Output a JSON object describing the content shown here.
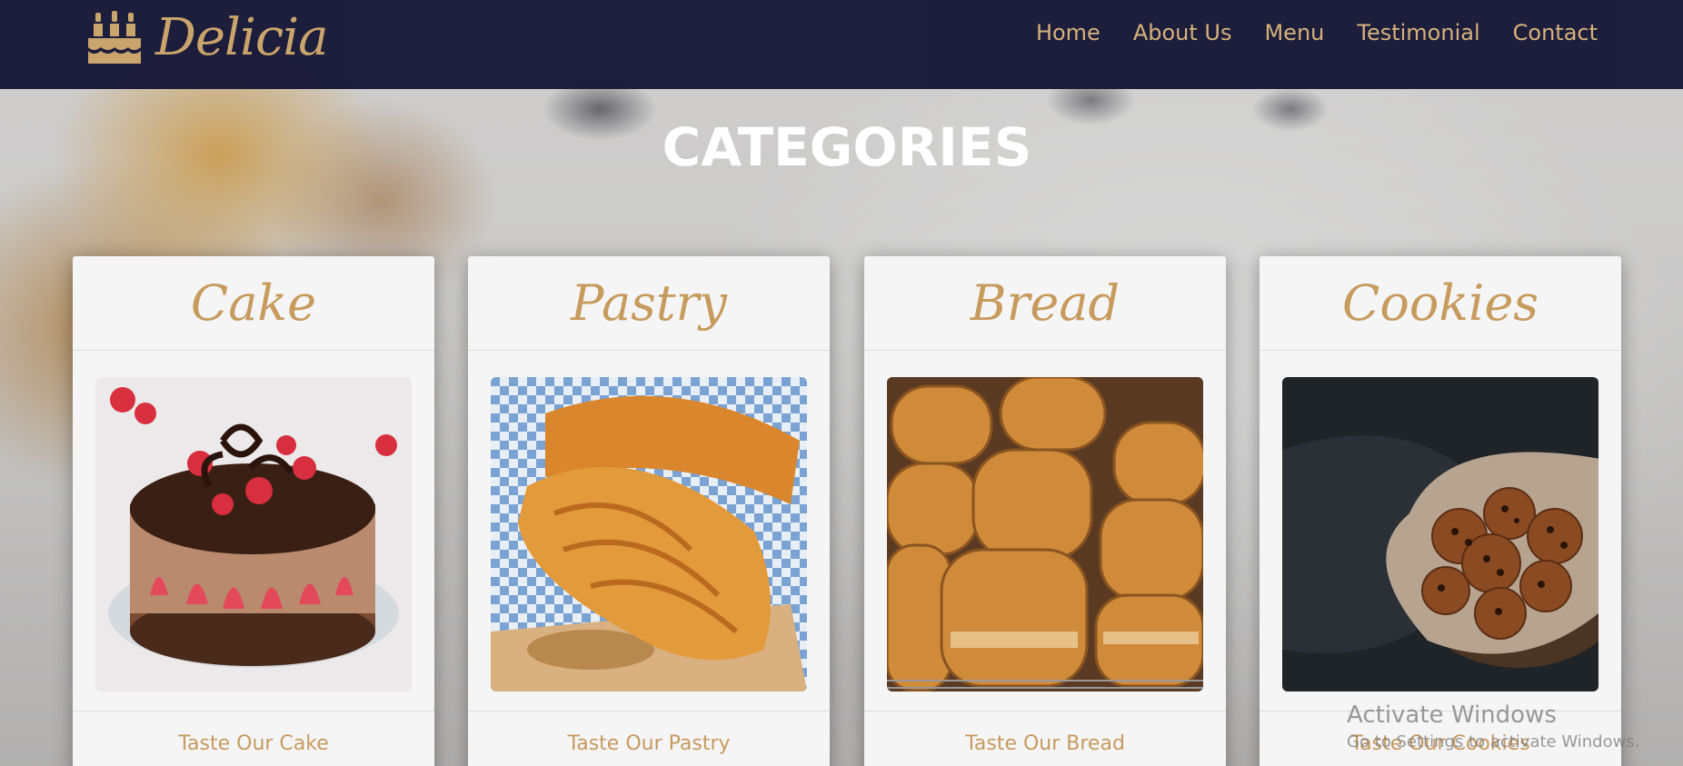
{
  "brand": {
    "name": "Delicia",
    "accent_color": "#c9a36a",
    "navbar_color": "#181838"
  },
  "nav": {
    "items": [
      "Home",
      "About Us",
      "Menu",
      "Testimonial",
      "Contact"
    ]
  },
  "section": {
    "title": "CATEGORIES"
  },
  "categories": [
    {
      "title": "Cake",
      "link": "Taste Our Cake",
      "image": "chocolate-strawberry-cake"
    },
    {
      "title": "Pastry",
      "link": "Taste Our Pastry",
      "image": "croissants"
    },
    {
      "title": "Bread",
      "link": "Taste Our Bread",
      "image": "bread-loaves"
    },
    {
      "title": "Cookies",
      "link": "Taste Our Cookies",
      "image": "chocolate-chip-cookies"
    }
  ],
  "os_watermark": {
    "title": "Activate Windows",
    "subtitle": "Go to Settings to activate Windows."
  }
}
